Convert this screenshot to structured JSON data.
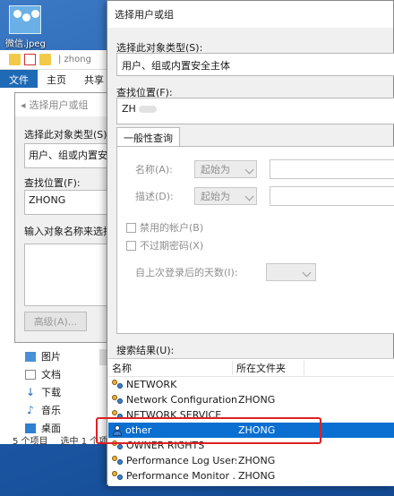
{
  "desktop": {
    "icon_label": "微信.jpeg"
  },
  "explorer": {
    "path_fragment": "| zhong",
    "tabs": [
      "文件",
      "主页",
      "共享"
    ],
    "nav_items": [
      {
        "label": "图片"
      },
      {
        "label": "文档"
      },
      {
        "label": "下载"
      },
      {
        "label": "音乐"
      },
      {
        "label": "桌面"
      }
    ],
    "status_count": "5 个项目",
    "status_selected": "选中 1 个项"
  },
  "back_dialog": {
    "title": "选择用户或组",
    "object_type_label": "选择此对象类型(S):",
    "object_type_value": "用户、组或内置安全主体",
    "location_label": "查找位置(F):",
    "location_value": "ZHONG",
    "enter_names_label": "输入对象名称来选择(E):",
    "advanced_button": "高级(A)..."
  },
  "dialog": {
    "title": "选择用户或组",
    "object_type_label": "选择此对象类型(S):",
    "object_type_value": "用户、组或内置安全主体",
    "location_label": "查找位置(F):",
    "location_value": "ZH",
    "tab_label": "一般性查询",
    "name_label": "名称(A):",
    "name_op": "起始为",
    "desc_label": "描述(D):",
    "desc_op": "起始为",
    "disabled_accounts": "禁用的帐户(B)",
    "no_expire_pwd": "不过期密码(X)",
    "days_since_login": "自上次登录后的天数(I):",
    "results_label": "搜索结果(U):",
    "columns": [
      "名称",
      "所在文件夹"
    ],
    "results": [
      {
        "name": "NETWORK",
        "folder": "",
        "icon": "group-icon",
        "selected": false
      },
      {
        "name": "Network Configuration...",
        "folder": "ZHONG",
        "icon": "group-icon",
        "selected": false
      },
      {
        "name": "NETWORK SERVICE",
        "folder": "",
        "icon": "group-icon",
        "selected": false
      },
      {
        "name": "other",
        "folder": "ZHONG",
        "icon": "user-icon",
        "selected": true
      },
      {
        "name": "OWNER RIGHTS",
        "folder": "",
        "icon": "group-icon",
        "selected": false
      },
      {
        "name": "Performance Log Users",
        "folder": "ZHONG",
        "icon": "group-icon",
        "selected": false
      },
      {
        "name": "Performance Monitor ...",
        "folder": "ZHONG",
        "icon": "group-icon",
        "selected": false
      }
    ],
    "highlight_color": "#e02020",
    "selection_color": "#0a6fd1"
  }
}
